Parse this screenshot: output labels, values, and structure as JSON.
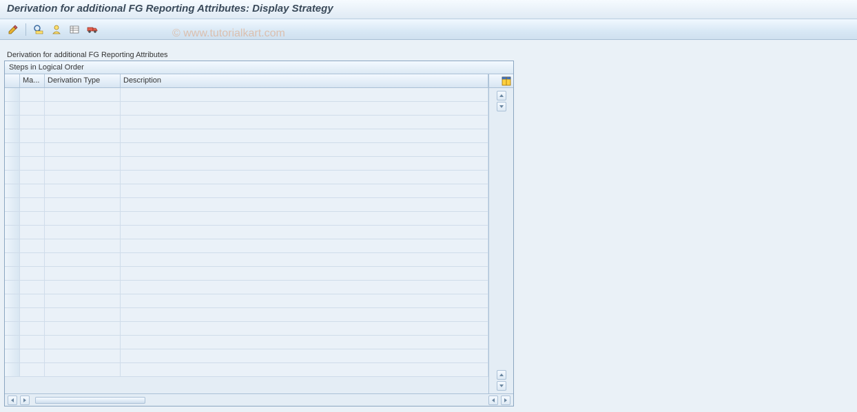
{
  "title": "Derivation for additional FG Reporting Attributes: Display Strategy",
  "watermark": "© www.tutorialkart.com",
  "toolbar": {
    "icons": {
      "pencil": "edit-icon",
      "detail": "detail-icon",
      "overview": "overview-icon",
      "entries": "entries-icon",
      "transport": "transport-icon"
    }
  },
  "section_label": "Derivation for additional FG Reporting Attributes",
  "table": {
    "title": "Steps in Logical Order",
    "columns": {
      "ma": "Ma...",
      "type": "Derivation Type",
      "desc": "Description"
    },
    "rows": [
      {
        "ma": "",
        "type": "",
        "desc": ""
      },
      {
        "ma": "",
        "type": "",
        "desc": ""
      },
      {
        "ma": "",
        "type": "",
        "desc": ""
      },
      {
        "ma": "",
        "type": "",
        "desc": ""
      },
      {
        "ma": "",
        "type": "",
        "desc": ""
      },
      {
        "ma": "",
        "type": "",
        "desc": ""
      },
      {
        "ma": "",
        "type": "",
        "desc": ""
      },
      {
        "ma": "",
        "type": "",
        "desc": ""
      },
      {
        "ma": "",
        "type": "",
        "desc": ""
      },
      {
        "ma": "",
        "type": "",
        "desc": ""
      },
      {
        "ma": "",
        "type": "",
        "desc": ""
      },
      {
        "ma": "",
        "type": "",
        "desc": ""
      },
      {
        "ma": "",
        "type": "",
        "desc": ""
      },
      {
        "ma": "",
        "type": "",
        "desc": ""
      },
      {
        "ma": "",
        "type": "",
        "desc": ""
      },
      {
        "ma": "",
        "type": "",
        "desc": ""
      },
      {
        "ma": "",
        "type": "",
        "desc": ""
      },
      {
        "ma": "",
        "type": "",
        "desc": ""
      },
      {
        "ma": "",
        "type": "",
        "desc": ""
      },
      {
        "ma": "",
        "type": "",
        "desc": ""
      },
      {
        "ma": "",
        "type": "",
        "desc": ""
      }
    ]
  }
}
